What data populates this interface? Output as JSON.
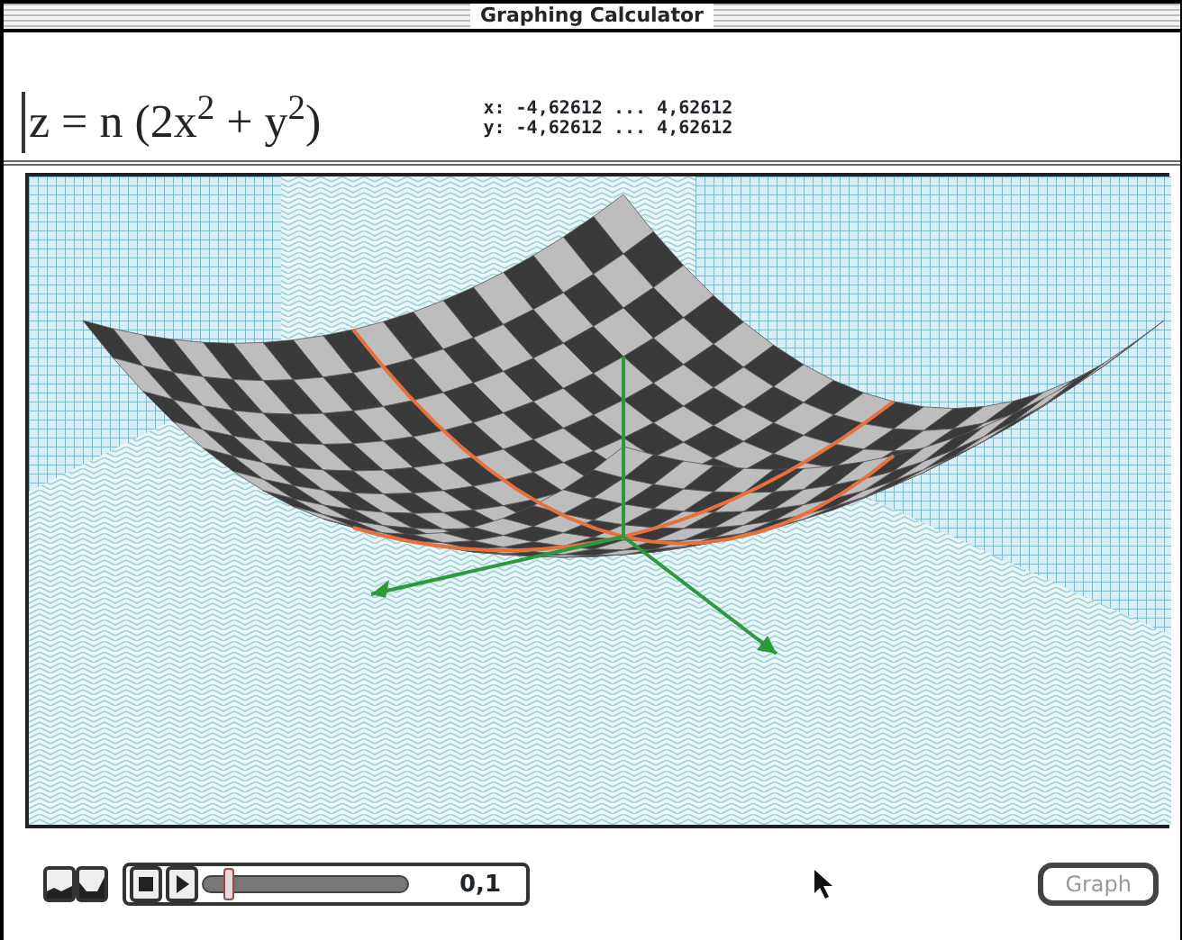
{
  "window": {
    "title": "Graphing Calculator"
  },
  "equation": "z = n (2x$^{2}$ + y$^{2}$)",
  "ranges": [
    "x: -4,62612 ... 4,62612",
    "y: -4,62612 ... 4,62612"
  ],
  "animation": {
    "level": 0.1,
    "value": "0,1"
  },
  "graph_button": {
    "label": "Graph",
    "disabled": true
  }
}
